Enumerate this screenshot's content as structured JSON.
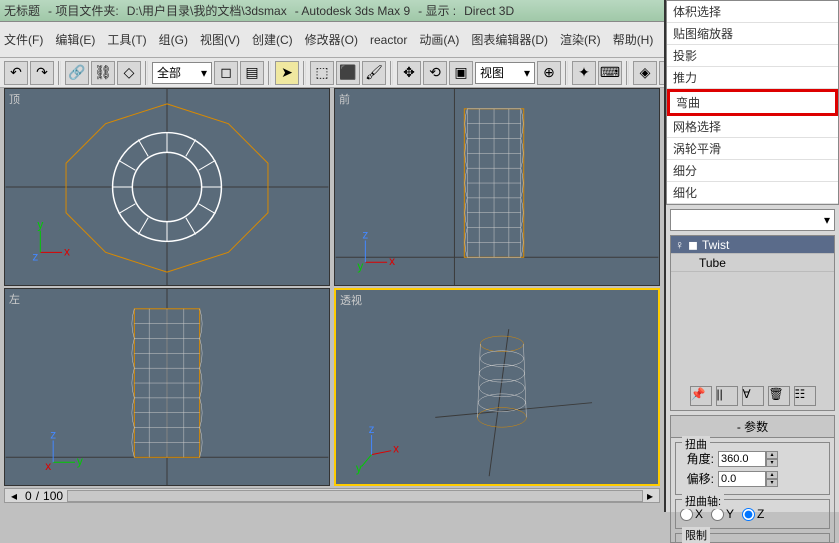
{
  "title": {
    "unsaved": "无标题",
    "project_prefix": "- 项目文件夹:",
    "project_path": "D:\\用户目录\\我的文档\\3dsmax",
    "app": "- Autodesk 3ds Max 9",
    "display_prefix": "- 显示 :",
    "display_mode": "Direct 3D"
  },
  "menu": [
    "文件(F)",
    "编辑(E)",
    "工具(T)",
    "组(G)",
    "视图(V)",
    "创建(C)",
    "修改器(O)",
    "reactor",
    "动画(A)",
    "图表编辑器(D)",
    "渲染(R)",
    "帮助(H)"
  ],
  "toolbar": {
    "filter_label": "全部",
    "view_label": "视图"
  },
  "viewports": {
    "tl": "顶",
    "tr": "前",
    "bl": "左",
    "br": "透视"
  },
  "timeline": {
    "current": "0",
    "sep": "/",
    "total": "100"
  },
  "axes": {
    "x": "x",
    "y": "y",
    "z": "z"
  },
  "side": {
    "modifier_options": [
      "体积选择",
      "贴图缩放器",
      "投影",
      "推力",
      "弯曲",
      "网格选择",
      "涡轮平滑",
      "细分",
      "细化"
    ],
    "highlighted_index": 4,
    "stack": {
      "item1": "Twist",
      "item2": "Tube",
      "bulb": "♀",
      "plus": "◼"
    },
    "params": {
      "title": "参数",
      "twist_group": "扭曲",
      "angle_label": "角度:",
      "angle_value": "360.0",
      "bias_label": "偏移:",
      "bias_value": "0.0",
      "axis_group": "扭曲轴:",
      "axis_x": "X",
      "axis_y": "Y",
      "axis_z": "Z",
      "limit_group": "限制"
    }
  }
}
